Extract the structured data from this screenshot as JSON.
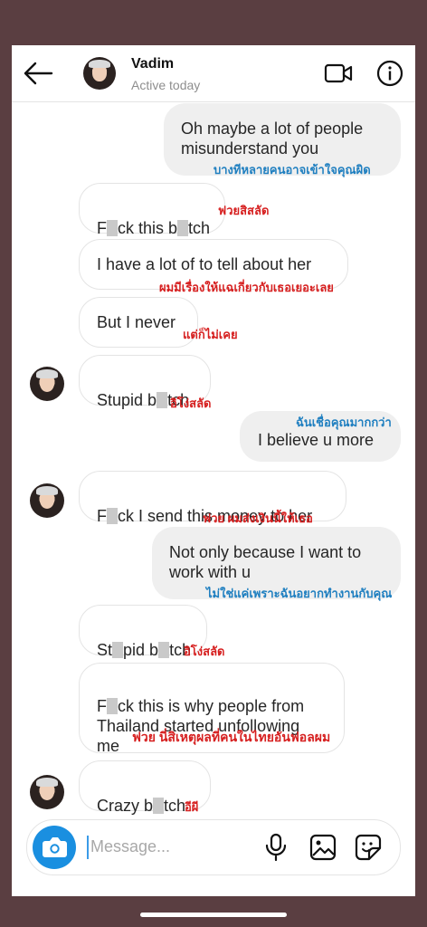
{
  "header": {
    "name": "Vadim",
    "status": "Active today"
  },
  "messages": [
    {
      "dir": "out",
      "text": "Oh maybe a lot of people\nmisunderstand you",
      "translation": "บางทีหลายคนอาจเข้าใจคุณผิด",
      "translation_color": "blue"
    },
    {
      "dir": "in",
      "parts": [
        "F",
        "ck this b",
        "tch"
      ],
      "translation": "ฟวยสิสลัด",
      "translation_color": "red"
    },
    {
      "dir": "in",
      "text": "I have a lot of to tell about her",
      "translation": "ผมมีเรื่องให้แฉเกี่ยวกับเธอเยอะเลย",
      "translation_color": "red"
    },
    {
      "dir": "in",
      "text": "But I never",
      "translation": "แต่ก็ไม่เคย",
      "translation_color": "red"
    },
    {
      "dir": "in",
      "parts": [
        "Stupid b",
        "tch"
      ],
      "translation": "อิโง่สลัด",
      "translation_color": "red"
    },
    {
      "dir": "out",
      "text": "I believe u more",
      "translation": "ฉันเชื่อคุณมากกว่า",
      "translation_color": "blue"
    },
    {
      "dir": "in",
      "parts": [
        "F",
        "ck I send this money to her"
      ],
      "translation": "ฟวย ผมส่งเงินนี้ให้เธอ",
      "translation_color": "red"
    },
    {
      "dir": "out",
      "text": "Not only because I want to\nwork with u",
      "translation": "ไม่ใช่แค่เพราะฉันอยากทำงานกับคุณ",
      "translation_color": "blue"
    },
    {
      "dir": "in",
      "parts": [
        "St",
        "pid b",
        "tch"
      ],
      "translation": "อิโง่สลัด",
      "translation_color": "red"
    },
    {
      "dir": "in",
      "parts": [
        "F",
        "ck this is why people from\nThailand started unfollowing\nme"
      ],
      "translation": "ฟวย นี่สิเหตุผลที่คนในไทยอันฟอลผม",
      "translation_color": "red"
    },
    {
      "dir": "in",
      "parts": [
        "Crazy b",
        "tch"
      ],
      "translation": "อีผี",
      "translation_color": "red"
    }
  ],
  "composer": {
    "placeholder": "Message..."
  },
  "icons": [
    "back-arrow-icon",
    "video-camera-icon",
    "info-icon",
    "camera-icon",
    "microphone-icon",
    "gallery-icon",
    "sticker-icon"
  ],
  "colors": {
    "accent": "#1a8fe0",
    "translation_red": "#d61f1f",
    "translation_blue": "#1f7fc0",
    "outgoing_bubble": "#efefef"
  }
}
